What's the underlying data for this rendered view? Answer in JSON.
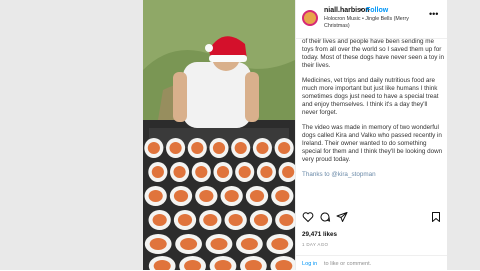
{
  "post": {
    "username": "niall.harbison",
    "separator": "•",
    "follow_label": "Follow",
    "music": "Holocron Music • Jingle Bells (Merry Christmas)",
    "more_label": "•••"
  },
  "caption": {
    "paragraphs": [
      "of their lives and people have been sending me toys from all over the world so I saved them up for today. Most of these dogs have never seen a toy in their lives.",
      "Medicines, vet trips and daily nutritious food are much more important but just like humans I think sometimes dogs just need to have a special treat and enjoy themselves. I think it's a day they'll never forget.",
      "The video was made in memory of two wonderful dogs called Kira and Valko who passed recently in Ireland. Their owner wanted to do something special for them and I think they'll be looking down very proud today.",
      "Thanks to @kira_stopman"
    ]
  },
  "actions": {
    "like_icon": "heart-icon",
    "comment_icon": "comment-icon",
    "share_icon": "share-icon",
    "save_icon": "bookmark-icon"
  },
  "likes": "29,471 likes",
  "time_ago": "1 DAY AGO",
  "login": {
    "link": "Log in",
    "rest": "to like or comment."
  },
  "colors": {
    "link_blue": "#0095f6",
    "santa_hat": "#d4102b",
    "bowl": "#f4f4f2",
    "food": "#e0743c"
  }
}
